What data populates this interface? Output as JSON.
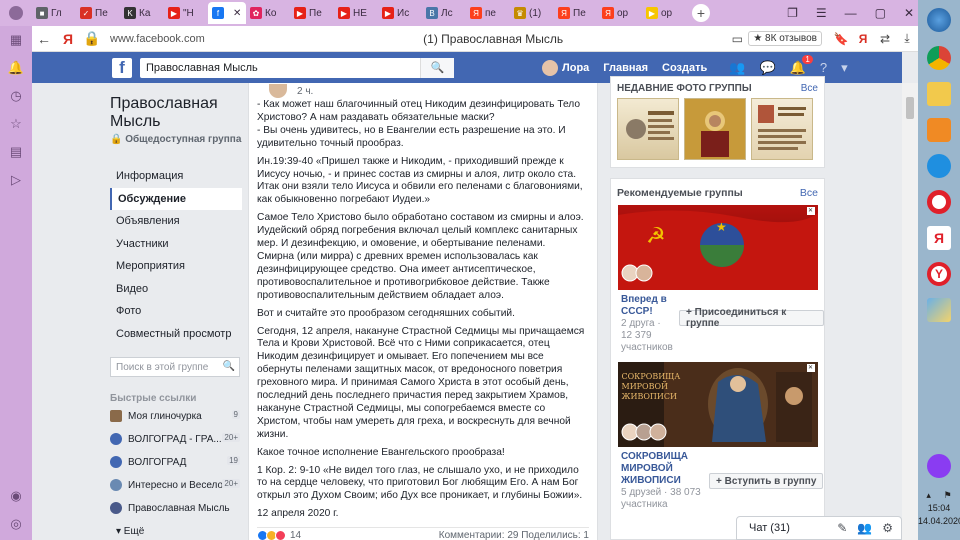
{
  "browser": {
    "tabs": [
      {
        "label": "Гл",
        "color": "#5f6368",
        "glyph": "■"
      },
      {
        "label": "Пе",
        "color": "#d93025",
        "glyph": "✓"
      },
      {
        "label": "Ка",
        "color": "#333333",
        "glyph": "K"
      },
      {
        "label": "\"Н",
        "color": "#e62117",
        "glyph": "▶"
      },
      {
        "label": "",
        "color": "#1877f2",
        "glyph": "f",
        "active": true
      },
      {
        "label": "Ко",
        "color": "#e0245e",
        "glyph": "✿"
      },
      {
        "label": "Пе",
        "color": "#e62117",
        "glyph": "▶"
      },
      {
        "label": "НЕ",
        "color": "#e62117",
        "glyph": "▶"
      },
      {
        "label": "Ис",
        "color": "#e62117",
        "glyph": "▶"
      },
      {
        "label": "Лс",
        "color": "#4a76a8",
        "glyph": "В"
      },
      {
        "label": "пе",
        "color": "#fc3f1d",
        "glyph": "Я"
      },
      {
        "label": "(1)",
        "color": "#c58b00",
        "glyph": "♛"
      },
      {
        "label": "Пе",
        "color": "#fc3f1d",
        "glyph": "Я"
      },
      {
        "label": "ор",
        "color": "#fc3f1d",
        "glyph": "Я"
      },
      {
        "label": "ор",
        "color": "#f7c600",
        "glyph": "▶"
      }
    ],
    "url": "www.facebook.com",
    "page_title": "(1) Православная Мысль",
    "reviews": "★ 8К отзывов"
  },
  "fb": {
    "search_value": "Православная Мысль",
    "user": "Лора",
    "home": "Главная",
    "create": "Создать",
    "notif_count": "1"
  },
  "group": {
    "name": "Православная Мысль",
    "type": "🔒 Общедоступная группа",
    "nav": [
      "Информация",
      "Обсуждение",
      "Объявления",
      "Участники",
      "Мероприятия",
      "Видео",
      "Фото",
      "Совместный просмотр"
    ],
    "search_placeholder": "Поиск в этой группе",
    "quick_links_title": "Быстрые ссылки",
    "quick_links": [
      {
        "label": "Моя глиночурка",
        "count": "9"
      },
      {
        "label": "ВОЛГОГРАД - ГРА...",
        "count": "20+"
      },
      {
        "label": "ВОЛГОГРАД",
        "count": "19"
      },
      {
        "label": "Интересно и Весело",
        "count": "20+"
      },
      {
        "label": "Православная Мысль",
        "count": ""
      }
    ],
    "more": "▾ Ещё"
  },
  "post": {
    "time": "2 ч.",
    "paragraphs": [
      "- Как может наш благочинный отец Никодим дезинфицировать Тело Христово? А нам раздавать обязательные маски?\n- Вы очень удивитесь, но в Евангелии есть разрешение на это. И удивительно точный прообраз.",
      "Ин.19:39-40 «Пришел также и Никодим, - приходивший прежде к Иисусу ночью, - и принес состав из смирны и алоя, литр около ста. Итак они взяли тело Иисуса и обвили его пеленами с благовониями, как обыкновенно погребают Иудеи.»",
      "Самое Тело Христово было обработано составом из смирны и алоэ. Иудейский обряд погребения включал целый комплекс санитарных мер. И дезинфекцию, и омовение, и обертывание пеленами.\nСмирна (или мирра) с древних времен использовалась как дезинфицирующее средство. Она имеет антисептическое, противовоспалительное и противогрибковое действие. Также противовоспалительным действием обладает алоэ.",
      "Вот и считайте это прообразом сегодняшних событий.",
      "Сегодня, 12 апреля, накануне Страстной Седмицы мы причащаемся Тела и Крови Христовой. Всё что с Ними соприкасается, отец Никодим дезинфицирует и омывает. Его попечением мы все обернуты пеленами защитных масок, от вредоносного поветрия греховного мира. И принимая Самого Христа в этот особый день, последний день последнего причастия перед закрытием Храмов, накануне Страстной Седмицы, мы сопогребаемся вместе со Христом, чтобы нам умереть для греха, и воскреснуть для вечной жизни.",
      "Какое точное исполнение Евангельского прообраза!",
      "1 Кор. 2: 9-10 «Не видел того глаз, не слышало ухо, и не приходило то на сердце человеку, что приготовил Бог любящим Его. А нам Бог открыл это Духом Своим; ибо Дух все проникает, и глубины Божии».",
      "12 апреля 2020 г."
    ],
    "reactions": "14",
    "stats": "Комментарии: 29   Поделились: 1"
  },
  "right": {
    "photos_title": "НЕДАВНИЕ ФОТО ГРУППЫ",
    "all": "Все",
    "rec_title": "Рекомендуемые группы",
    "rec": [
      {
        "name": "Вперед в СССР!",
        "friends": "2 друга ·",
        "members": "12 379",
        "members_label": "участников",
        "join": "+ Присоединиться к группе"
      },
      {
        "name": "СОКРОВИЩА МИРОВОЙ ЖИВОПИСИ",
        "friends": "5 друзей · 38 073",
        "members_label": "участника",
        "join": "+ Вступить в группу",
        "img_caption": "Сокровища мировой живописи"
      }
    ]
  },
  "chat": {
    "label": "Чат (31)"
  },
  "clock": {
    "time": "15:04",
    "date": "14.04.2020"
  }
}
